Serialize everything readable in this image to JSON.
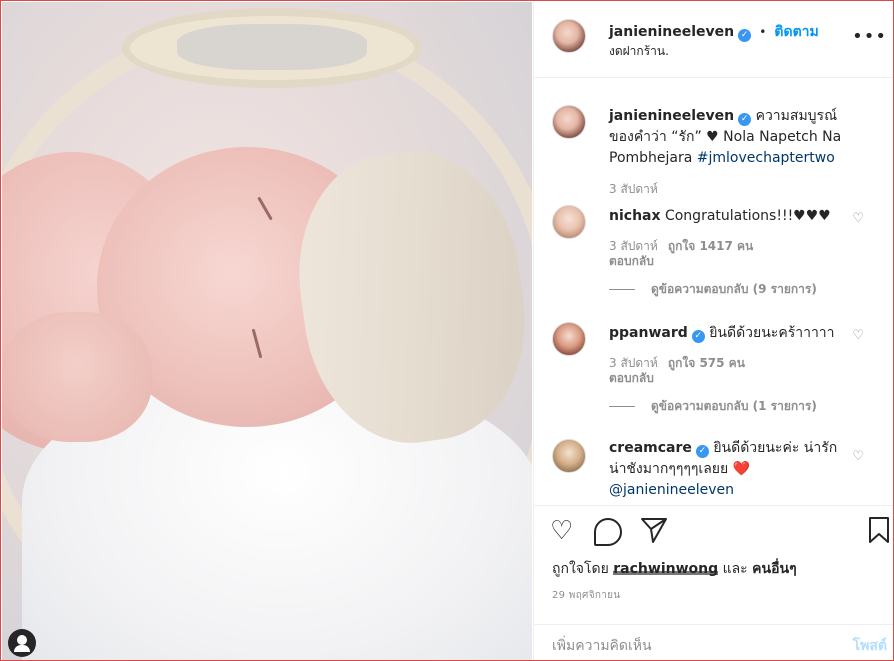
{
  "post": {
    "author": "janienineeleven",
    "follow_label": "ติดตาม",
    "separator": "•",
    "more_icon": "•••",
    "location": "งดฝากร้าน."
  },
  "caption": {
    "author": "janienineeleven",
    "text_before": "ความสมบูรณ์ของคำว่า “รัก” ♥ Nola Napetch Na Pombhejara ",
    "hashtag": "#jmlovechaptertwo",
    "time": "3 สัปดาห์"
  },
  "comments": [
    {
      "author": "nichax",
      "text": "Congratulations!!!♥♥♥",
      "time": "3 สัปดาห์",
      "likes": "ถูกใจ 1417 คน",
      "reply": "ตอบกลับ",
      "view_replies": "ดูข้อความตอบกลับ (9 รายการ)"
    },
    {
      "author": "ppanward",
      "text": "ยินดีด้วยนะคร้าาาาา",
      "time": "3 สัปดาห์",
      "likes": "ถูกใจ 575 คน",
      "reply": "ตอบกลับ",
      "view_replies": "ดูข้อความตอบกลับ (1 รายการ)"
    },
    {
      "author": "creamcare",
      "text": "ยินดีด้วยนะค่ะ น่ารักน่าชังมากๆๆๆๆเลยย ❤️",
      "mention": "@janienineeleven"
    }
  ],
  "actions": {
    "liked_by_prefix": "ถูกใจโดย ",
    "liked_by_user": "rachwinwong",
    "liked_by_and": " และ ",
    "liked_by_others": "คนอื่นๆ",
    "date": "29 พฤศจิกายน"
  },
  "add_comment": {
    "placeholder": "เพิ่มความคิดเห็น",
    "post_label": "โพสต์"
  },
  "colors": {
    "link": "#0095f6",
    "verified": "#3897f0",
    "muted": "#8e8e8e",
    "text": "#262626"
  }
}
